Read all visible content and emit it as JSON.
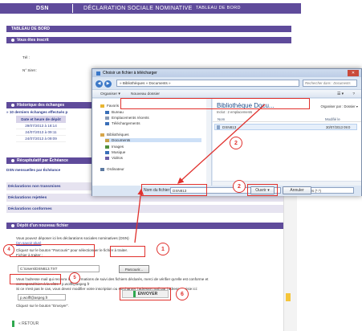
{
  "topnav": {
    "dsn": "DSN",
    "title": "DÉCLARATION SOCIALE NOMINATIVE",
    "dashboard": "TABLEAU DE BORD"
  },
  "page": {
    "dashboard_header": "TABLEAU DE BORD",
    "inscrit_header": "Vous êtes inscrit",
    "tel_label": "Tél :",
    "siret_label": "N° Siret :",
    "historique_header": "Historique des échanges",
    "derniers": "» 10 derniers échanges effectués p",
    "table": {
      "header": "Date et heure de dépôt",
      "rows": [
        "29/07/2013 à 18:14",
        "24/07/2013 à 09:11",
        "24/07/2013 à 09:09"
      ]
    },
    "recap_header": "Récapitulatif par Échéance",
    "dsn_mensuelles": "DSN mensuelles par Échéance",
    "decl_non": "Déclarations non transmises",
    "decl_rejetees": "Déclarations rejetées",
    "decl_conformes": "Déclarations conformes",
    "depot_header": "Dépôt d'un nouveau fichier",
    "depot_line1": "Vous pouvez déposer ici les déclarations sociales nominatives (DSN)",
    "depot_link": "(en savoir plus)",
    "depot_line2": "Cliquez sur le bouton \"Parcourir\" pour sélectionner le fichier à traiter.",
    "fichier_label": "Fichier à traiter :",
    "file_value": "C:\\Users\\DSN813.TXT",
    "parcourir": "Parcourir...",
    "notif1": "Vous l'adresse mail qui recevra les informations de suivi des fichiers déclarés, merci de vérifier qu'elle est conforme et",
    "notif2": "correspond bien à la vôtre : p.wolff@aspeg.fr",
    "notif3": "Si ce n'est pas le cas, vous devez modifier votre inscription ou surcharger l'adresse mail par l'adresse saisie ici:",
    "email_value": "p.wolff@aspeg.fr",
    "envoyer_hint": "Cliquez sur le bouton \"Envoyer\".",
    "envoyer": "ENVOYER",
    "retour": "« RETOUR"
  },
  "dialog": {
    "title": "Choisir un fichier à télécharger",
    "path": "» Bibliothèques » Documents »",
    "search_placeholder": "Rechercher dans : Documents",
    "organiser": "Organiser ▾",
    "nouveau_dossier": "Nouveau dossier",
    "nav": {
      "favoris": "Favoris",
      "bureau": "Bureau",
      "emplacements": "Emplacements récents",
      "telechargements": "Téléchargements",
      "bibliotheques": "Bibliothèques",
      "documents": "Documents",
      "images": "Images",
      "musique": "Musique",
      "videos": "Vidéos",
      "ordinateur": "Ordinateur"
    },
    "library_title": "Bibliothèque Docu...",
    "library_sub": "Inclut : 2 emplacements",
    "organiser_par": "Organiser par :  Dossier ▾",
    "col_nom": "Nom",
    "col_modif": "Modifié le",
    "file_name": "DSN813",
    "file_date": "30/07/2013 09:0",
    "nom_label": "Nom du fichier :",
    "nom_value": "DSN813",
    "type_value": "Tous les fichiers (*.*)",
    "ouvrir": "Ouvrir",
    "annuler": "Annuler"
  },
  "annotations": [
    "1",
    "2",
    "2",
    "4",
    "5",
    "6"
  ],
  "colors": {
    "header_purple": "#5f4b9b",
    "annotation_red": "#e0312d",
    "send_green": "#2fa84f"
  }
}
